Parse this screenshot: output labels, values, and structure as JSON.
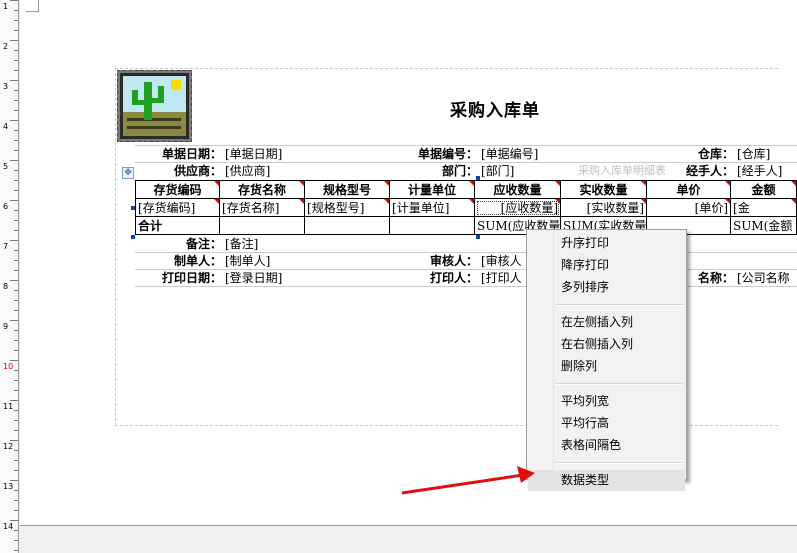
{
  "ruler": {
    "labels": [
      "1",
      "2",
      "3",
      "4",
      "5",
      "6",
      "7",
      "8",
      "9",
      "10",
      "11",
      "12",
      "13",
      "14"
    ]
  },
  "report": {
    "title": "采购入库单",
    "watermark": "采购入库单明细表",
    "header_row1": [
      {
        "label": "单据日期：",
        "value": "[单据日期]"
      },
      {
        "label": "单据编号：",
        "value": "[单据编号]"
      },
      {
        "label": "仓库：",
        "value": "[仓库]"
      }
    ],
    "header_row2": [
      {
        "label": "供应商：",
        "value": "[供应商]"
      },
      {
        "label": "部门：",
        "value": "[部门]"
      },
      {
        "label": "经手人：",
        "value": "[经手人]"
      }
    ],
    "columns": [
      "存货编码",
      "存货名称",
      "规格型号",
      "计量单位",
      "应收数量",
      "实收数量",
      "单价",
      "金额"
    ],
    "detail_row": [
      "[存货编码]",
      "[存货名称]",
      "[规格型号]",
      "[计量单位]",
      "[应收数量]",
      "[实收数量]",
      "[单价]",
      "[金"
    ],
    "total_row": [
      "合计",
      "",
      "",
      "",
      "SUM(应收数量",
      "SUM(实收数量",
      "",
      "SUM(金额"
    ],
    "footer": {
      "remark_label": "备注：",
      "remark_value": "[备注]",
      "maker_label": "制单人：",
      "maker_value": "[制单人]",
      "checker_label": "审核人：",
      "checker_value": "[审核人",
      "print_date_label": "打印日期：",
      "print_date_value": "[登录日期]",
      "printer_label": "打印人：",
      "printer_value": "[打印人",
      "company_label": "名称：",
      "company_value": "[公司名称"
    }
  },
  "context_menu": {
    "groups": [
      [
        "升序打印",
        "降序打印",
        "多列排序"
      ],
      [
        "在左侧插入列",
        "在右侧插入列",
        "删除列"
      ],
      [
        "平均列宽",
        "平均行高",
        "表格间隔色"
      ],
      [
        "数据类型"
      ]
    ]
  },
  "colors": {
    "arrow": "#e01010",
    "triangle": "#e00000",
    "handle": "#1040c0"
  }
}
